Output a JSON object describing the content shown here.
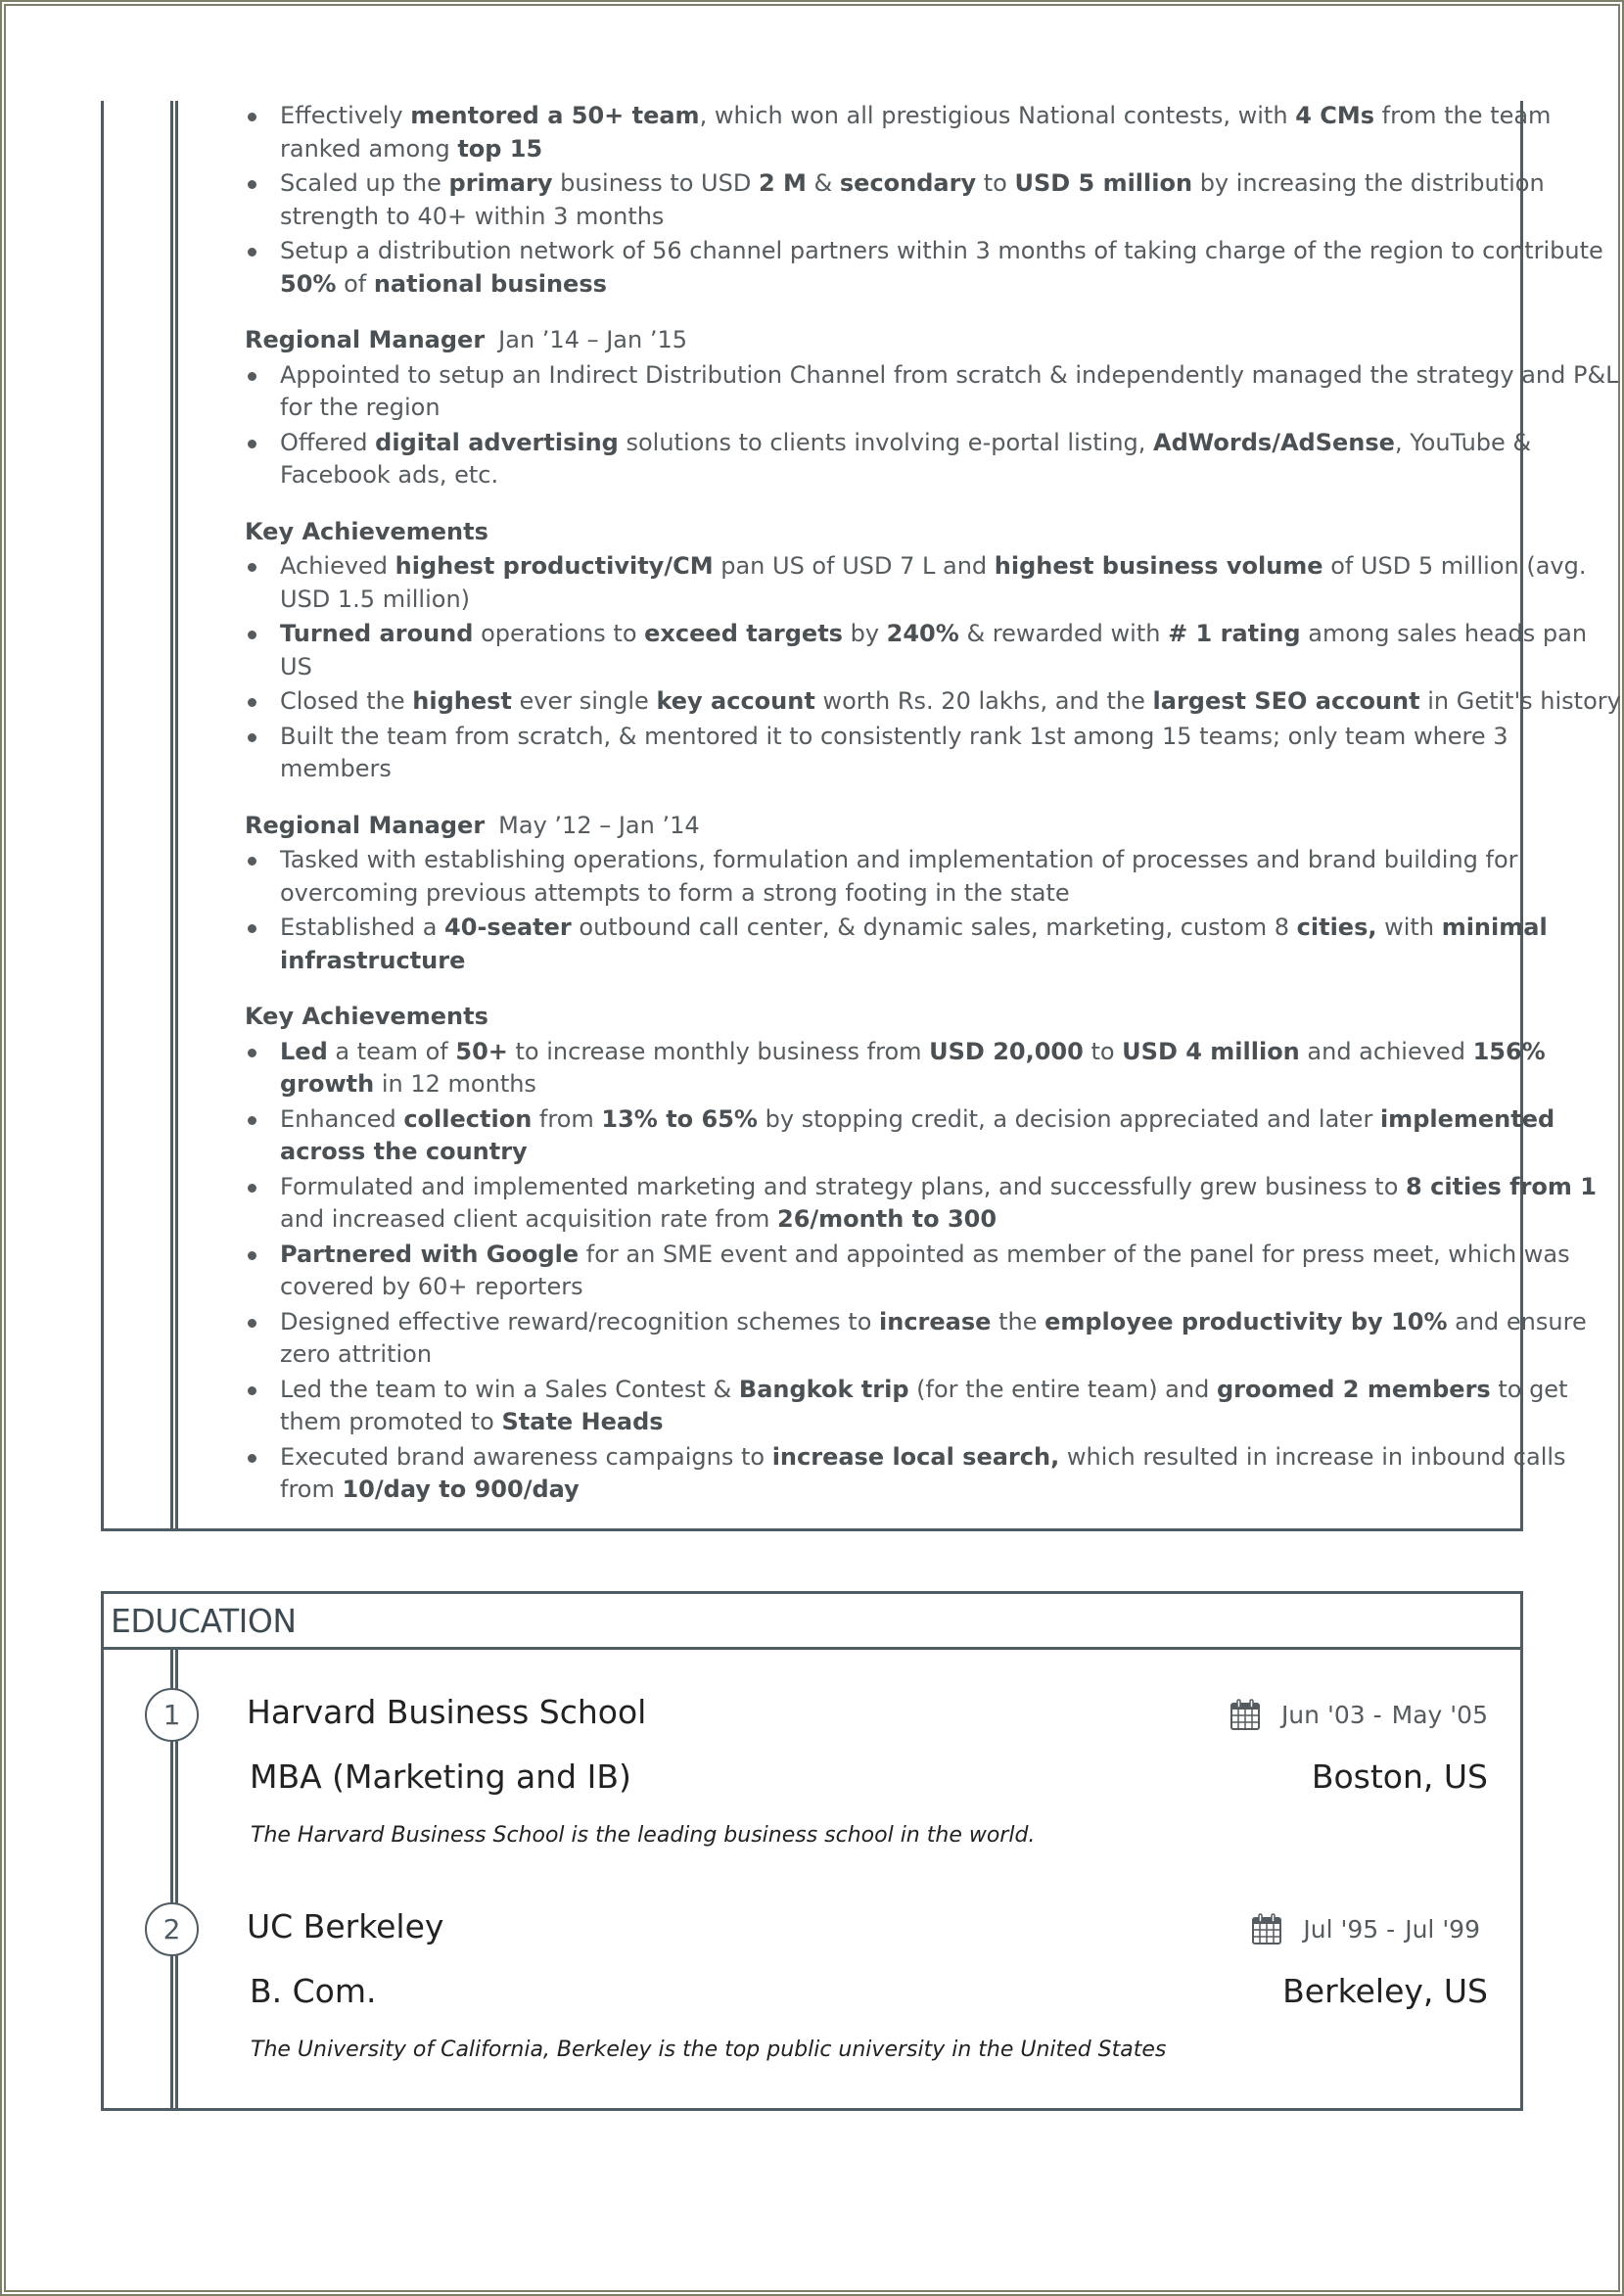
{
  "experience_continued": {
    "intro_bullets": [
      {
        "segments": [
          {
            "t": "Effectively "
          },
          {
            "t": "mentored a 50+ team",
            "b": true
          },
          {
            "t": ", which won all prestigious National contests, with "
          },
          {
            "t": "4 CMs",
            "b": true
          },
          {
            "t": " from the team ranked among "
          },
          {
            "t": "top 15",
            "b": true
          }
        ]
      },
      {
        "segments": [
          {
            "t": "Scaled up the "
          },
          {
            "t": "primary",
            "b": true
          },
          {
            "t": " business to USD "
          },
          {
            "t": "2 M",
            "b": true
          },
          {
            "t": " & "
          },
          {
            "t": "secondary",
            "b": true
          },
          {
            "t": " to "
          },
          {
            "t": "USD 5 million",
            "b": true
          },
          {
            "t": " by increasing the distribution strength to 40+ within 3 months"
          }
        ]
      },
      {
        "segments": [
          {
            "t": "Setup a distribution network of 56 channel partners within 3 months of taking charge of the region to contribute "
          },
          {
            "t": "50%",
            "b": true
          },
          {
            "t": " of "
          },
          {
            "t": "national business",
            "b": true
          }
        ]
      }
    ],
    "roles": [
      {
        "title": "Regional Manager",
        "dates": "Jan ’14 – Jan ’15",
        "bullets": [
          {
            "segments": [
              {
                "t": "Appointed to setup an Indirect Distribution Channel from scratch & independently managed the strategy and P&L for the region"
              }
            ]
          },
          {
            "segments": [
              {
                "t": "Offered "
              },
              {
                "t": "digital advertising",
                "b": true
              },
              {
                "t": " solutions to clients involving e-portal listing, "
              },
              {
                "t": "AdWords/AdSense",
                "b": true
              },
              {
                "t": ", YouTube & Facebook ads, etc."
              }
            ]
          }
        ],
        "achievements_label": "Key Achievements",
        "achievements": [
          {
            "segments": [
              {
                "t": "Achieved "
              },
              {
                "t": "highest productivity/CM",
                "b": true
              },
              {
                "t": " pan US of USD 7 L and "
              },
              {
                "t": "highest business volume",
                "b": true
              },
              {
                "t": " of USD 5 million (avg. USD 1.5 million)"
              }
            ]
          },
          {
            "segments": [
              {
                "t": "Turned around",
                "b": true
              },
              {
                "t": " operations to "
              },
              {
                "t": "exceed targets",
                "b": true
              },
              {
                "t": " by "
              },
              {
                "t": "240%",
                "b": true
              },
              {
                "t": " & rewarded with "
              },
              {
                "t": "# 1 rating",
                "b": true
              },
              {
                "t": " among sales heads pan US"
              }
            ]
          },
          {
            "segments": [
              {
                "t": "Closed the "
              },
              {
                "t": "highest",
                "b": true
              },
              {
                "t": " ever single "
              },
              {
                "t": "key account",
                "b": true
              },
              {
                "t": " worth Rs. 20 lakhs, and the "
              },
              {
                "t": "largest SEO account",
                "b": true
              },
              {
                "t": "  in Getit's history"
              }
            ]
          },
          {
            "segments": [
              {
                "t": "Built the team from scratch, & mentored it to consistently rank 1st among 15 teams; only team where 3 members"
              }
            ]
          }
        ]
      },
      {
        "title": "Regional Manager",
        "dates": "May ’12 – Jan ’14",
        "bullets": [
          {
            "segments": [
              {
                "t": "Tasked with establishing operations, formulation and implementation of processes and brand building for overcoming previous attempts to form a strong footing in the state"
              }
            ]
          },
          {
            "segments": [
              {
                "t": "Established a "
              },
              {
                "t": "40-seater",
                "b": true
              },
              {
                "t": " outbound call center, & dynamic sales, marketing, custom 8 "
              },
              {
                "t": "cities,",
                "b": true
              },
              {
                "t": " with "
              },
              {
                "t": "minimal infrastructure",
                "b": true
              }
            ]
          }
        ],
        "achievements_label": "Key Achievements",
        "achievements": [
          {
            "segments": [
              {
                "t": "Led",
                "b": true
              },
              {
                "t": " a team of "
              },
              {
                "t": "50+",
                "b": true
              },
              {
                "t": " to increase monthly business from "
              },
              {
                "t": "USD 20,000",
                "b": true
              },
              {
                "t": " to "
              },
              {
                "t": "USD 4 million",
                "b": true
              },
              {
                "t": " and achieved "
              },
              {
                "t": "156% growth",
                "b": true
              },
              {
                "t": " in 12 months"
              }
            ]
          },
          {
            "segments": [
              {
                "t": "Enhanced "
              },
              {
                "t": "collection",
                "b": true
              },
              {
                "t": " from "
              },
              {
                "t": "13% to 65%",
                "b": true
              },
              {
                "t": " by stopping credit, a decision appreciated and later "
              },
              {
                "t": "implemented across the country",
                "b": true
              }
            ]
          },
          {
            "segments": [
              {
                "t": "Formulated and implemented marketing and strategy plans, and successfully grew business to "
              },
              {
                "t": "8 cities from 1",
                "b": true
              },
              {
                "t": " and increased client acquisition rate from "
              },
              {
                "t": "26/month to 300",
                "b": true
              }
            ]
          },
          {
            "segments": [
              {
                "t": "Partnered with Google",
                "b": true
              },
              {
                "t": " for an SME event and appointed as member of the panel for press meet, which was covered by 60+ reporters"
              }
            ]
          },
          {
            "segments": [
              {
                "t": "Designed effective reward/recognition schemes to "
              },
              {
                "t": "increase",
                "b": true
              },
              {
                "t": " the "
              },
              {
                "t": "employee productivity by 10%",
                "b": true
              },
              {
                "t": " and ensure zero attrition"
              }
            ]
          },
          {
            "segments": [
              {
                "t": "Led the team to win a Sales Contest & "
              },
              {
                "t": "Bangkok trip",
                "b": true
              },
              {
                "t": " (for the entire team) and "
              },
              {
                "t": "groomed 2 members",
                "b": true
              },
              {
                "t": " to get them promoted to "
              },
              {
                "t": "State Heads",
                "b": true
              }
            ]
          },
          {
            "segments": [
              {
                "t": "Executed brand awareness campaigns to "
              },
              {
                "t": "increase local search,",
                "b": true
              },
              {
                "t": " which resulted in increase in inbound calls from "
              },
              {
                "t": "10/day to 900/day",
                "b": true
              }
            ]
          }
        ]
      }
    ]
  },
  "education": {
    "title": "EDUCATION",
    "items": [
      {
        "number": "1",
        "school": "Harvard Business School",
        "date_start": "Jun '03",
        "date_sep": "-",
        "date_end": "May '05",
        "degree": "MBA (Marketing and IB)",
        "location": "Boston, US",
        "description": "The Harvard Business School is the leading business school in the world.",
        "icon": "calendar-icon"
      },
      {
        "number": "2",
        "school": "UC Berkeley",
        "date_start": "Jul '95",
        "date_sep": "-",
        "date_end": "Jul '99",
        "degree": "B. Com.",
        "location": "Berkeley, US",
        "description": "The University of California, Berkeley is the top public university in the United States",
        "icon": "calendar-icon"
      }
    ]
  },
  "colors": {
    "frame": "#505c63",
    "page_border": "#7f7f68",
    "body_text": "#555b5e",
    "heading_text": "#3d4a52"
  }
}
